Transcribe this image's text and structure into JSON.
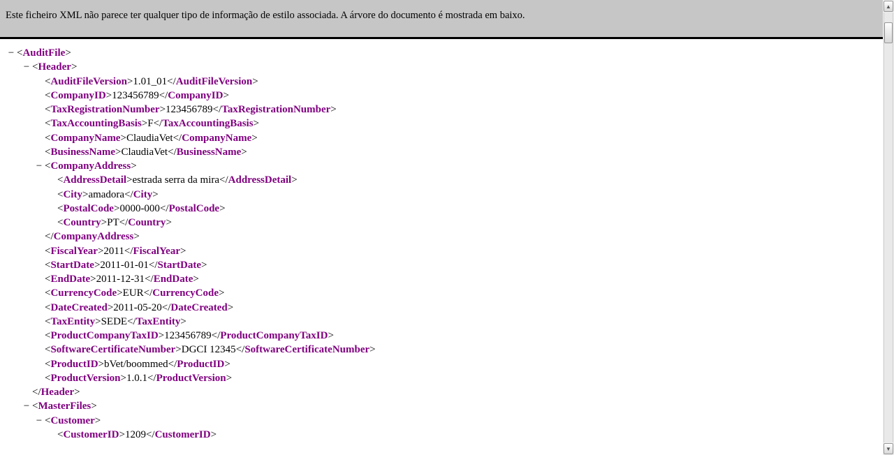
{
  "notice": "Este ficheiro XML não parece ter qualquer tipo de informação de estilo associada. A árvore do documento é mostrada em baixo.",
  "toggle": "−",
  "tags": {
    "AuditFile": "AuditFile",
    "Header": "Header",
    "AuditFileVersion": "AuditFileVersion",
    "CompanyID": "CompanyID",
    "TaxRegistrationNumber": "TaxRegistrationNumber",
    "TaxAccountingBasis": "TaxAccountingBasis",
    "CompanyName": "CompanyName",
    "BusinessName": "BusinessName",
    "CompanyAddress": "CompanyAddress",
    "AddressDetail": "AddressDetail",
    "City": "City",
    "PostalCode": "PostalCode",
    "Country": "Country",
    "FiscalYear": "FiscalYear",
    "StartDate": "StartDate",
    "EndDate": "EndDate",
    "CurrencyCode": "CurrencyCode",
    "DateCreated": "DateCreated",
    "TaxEntity": "TaxEntity",
    "ProductCompanyTaxID": "ProductCompanyTaxID",
    "SoftwareCertificateNumber": "SoftwareCertificateNumber",
    "ProductID": "ProductID",
    "ProductVersion": "ProductVersion",
    "MasterFiles": "MasterFiles",
    "Customer": "Customer",
    "CustomerID": "CustomerID"
  },
  "vals": {
    "AuditFileVersion": "1.01_01",
    "CompanyID": "123456789",
    "TaxRegistrationNumber": "123456789",
    "TaxAccountingBasis": "F",
    "CompanyName": "ClaudiaVet",
    "BusinessName": "ClaudiaVet",
    "AddressDetail": "estrada serra da mira",
    "City": "amadora",
    "PostalCode": "0000-000",
    "Country": "PT",
    "FiscalYear": "2011",
    "StartDate": "2011-01-01",
    "EndDate": "2011-12-31",
    "CurrencyCode": "EUR",
    "DateCreated": "2011-05-20",
    "TaxEntity": "SEDE",
    "ProductCompanyTaxID": "123456789",
    "SoftwareCertificateNumber": "DGCI 12345",
    "ProductID": "bVet/boommed",
    "ProductVersion": "1.0.1",
    "CustomerID": "1209"
  }
}
